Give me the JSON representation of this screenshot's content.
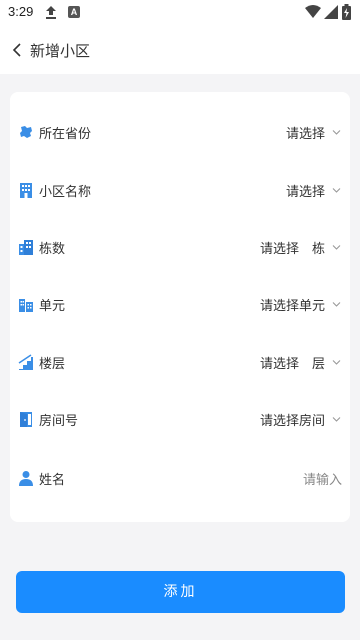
{
  "status_bar": {
    "time": "3:29",
    "indicator_letter": "A"
  },
  "header": {
    "title": "新增小区"
  },
  "form": {
    "rows": [
      {
        "label": "所在省份",
        "value": "请选择",
        "icon": "map-icon"
      },
      {
        "label": "小区名称",
        "value": "请选择",
        "icon": "building-icon"
      },
      {
        "label": "栋数",
        "value": "请选择　栋",
        "icon": "buildings-icon"
      },
      {
        "label": "单元",
        "value": "请选择单元",
        "icon": "unit-icon"
      },
      {
        "label": "楼层",
        "value": "请选择　层",
        "icon": "stairs-icon"
      },
      {
        "label": "房间号",
        "value": "请选择房间",
        "icon": "door-icon"
      },
      {
        "label": "姓名",
        "placeholder": "请输入",
        "icon": "person-icon"
      }
    ]
  },
  "add_button": {
    "label": "添加"
  },
  "colors": {
    "accent": "#1a8cff",
    "icon": "#3a8ee6",
    "background": "#f4f4f6"
  }
}
